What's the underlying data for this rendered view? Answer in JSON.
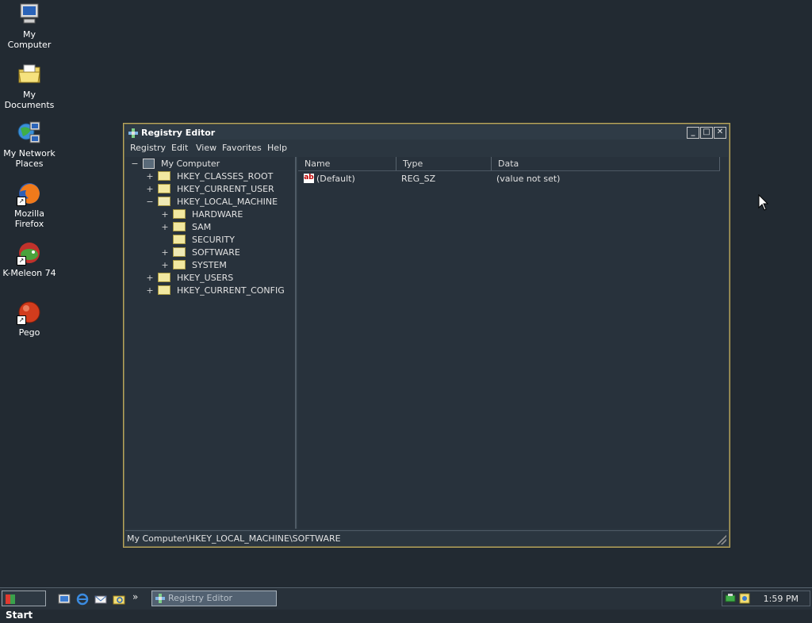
{
  "desktop": {
    "icons": [
      {
        "label": "My Computer",
        "icon": "my-computer-icon"
      },
      {
        "label": "My Documents",
        "icon": "my-documents-icon"
      },
      {
        "label": "My Network Places",
        "icon": "network-places-icon"
      },
      {
        "label": "Mozilla Firefox",
        "icon": "firefox-icon"
      },
      {
        "label": "K-Meleon 74",
        "icon": "kmeleon-icon"
      },
      {
        "label": "Pego",
        "icon": "pego-icon"
      }
    ]
  },
  "window": {
    "title": "Registry Editor",
    "controls": {
      "minimize": "_",
      "maximize": "□",
      "close": "✕"
    },
    "menu": [
      "Registry",
      "Edit",
      "View",
      "Favorites",
      "Help"
    ],
    "tree": [
      {
        "label": "My Computer",
        "expander": "−"
      },
      {
        "label": "HKEY_CLASSES_ROOT",
        "expander": "+"
      },
      {
        "label": "HKEY_CURRENT_USER",
        "expander": "+"
      },
      {
        "label": "HKEY_LOCAL_MACHINE",
        "expander": "−"
      },
      {
        "label": "HARDWARE",
        "expander": "+"
      },
      {
        "label": "SAM",
        "expander": "+"
      },
      {
        "label": "SECURITY",
        "expander": ""
      },
      {
        "label": "SOFTWARE",
        "expander": "+"
      },
      {
        "label": "SYSTEM",
        "expander": "+"
      },
      {
        "label": "HKEY_USERS",
        "expander": "+"
      },
      {
        "label": "HKEY_CURRENT_CONFIG",
        "expander": "+"
      }
    ],
    "list": {
      "columns": [
        "Name",
        "Type",
        "Data"
      ],
      "rows": [
        {
          "name": "(Default)",
          "type": "REG_SZ",
          "data": "(value not set)"
        }
      ]
    },
    "status": "My Computer\\HKEY_LOCAL_MACHINE\\SOFTWARE"
  },
  "taskbar": {
    "start_label": "Start",
    "overflow": "»",
    "task_button": "Registry Editor",
    "clock": "1:59 PM"
  },
  "colors": {
    "desktop": "#222a32",
    "window_border": "#b9a55a",
    "folder": "#f2e8a0"
  }
}
